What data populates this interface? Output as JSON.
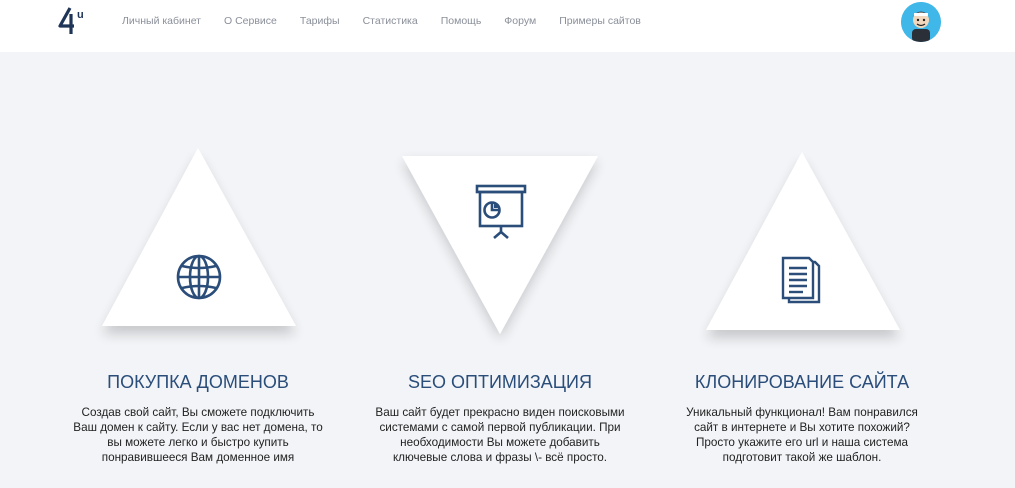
{
  "header": {
    "logo_text": "4u",
    "nav": [
      "Личный кабинет",
      "О Сервисе",
      "Тарифы",
      "Статистика",
      "Помощь",
      "Форум",
      "Примеры сайтов"
    ]
  },
  "features": [
    {
      "title": "ПОКУПКА ДОМЕНОВ",
      "desc_lines": [
        "Создав свой сайт, Вы сможете подключить",
        "Ваш домен к сайту. Если у вас нет домена, то",
        "вы можете легко и быстро купить",
        "понравившееся Вам доменное имя"
      ],
      "icon": "globe-icon"
    },
    {
      "title": "SEO ОПТИМИЗАЦИЯ",
      "desc_lines": [
        "Ваш сайт будет прекрасно виден  поисковыми",
        "системами с самой первой  публикации. При",
        "необходимости Вы  можете добавить",
        "ключевые слова и фразы  \\- всё просто."
      ],
      "icon": "presentation-chart-icon"
    },
    {
      "title": "КЛОНИРОВАНИЕ САЙТА",
      "desc_lines": [
        "Уникальный функционал! Вам понравился",
        "сайт в  интернете и Вы хотите похожий?",
        "Просто укажите его url и  наша система",
        "подготовит такой же  шаблон."
      ],
      "icon": "documents-icon"
    }
  ],
  "colors": {
    "accent": "#2a4d7a",
    "background": "#f2f4f7",
    "avatar_bg": "#3fb7e8"
  }
}
